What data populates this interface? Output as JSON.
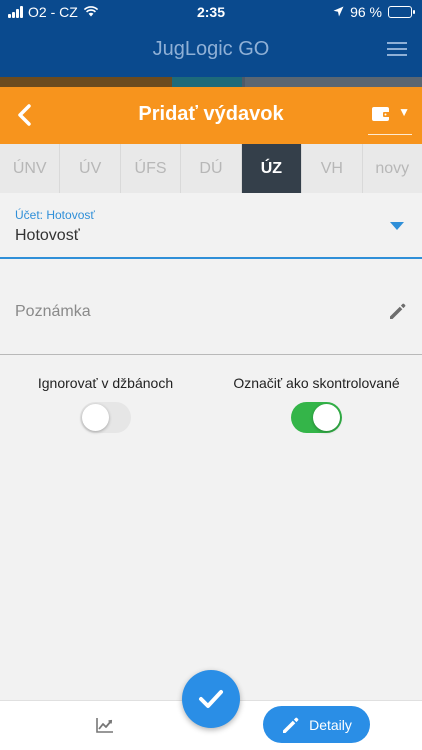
{
  "status": {
    "carrier": "O2 - CZ",
    "time": "2:35",
    "battery": "96 %",
    "battery_level": 0.96
  },
  "app": {
    "title": "JugLogic GO",
    "menu_icon": "hamburger-icon"
  },
  "modal": {
    "title": "Pridať výdavok",
    "back_icon": "chevron-left-icon",
    "wallet_icon": "wallet-icon"
  },
  "tabs": [
    {
      "label": "ÚNV",
      "active": false
    },
    {
      "label": "ÚV",
      "active": false
    },
    {
      "label": "ÚFS",
      "active": false
    },
    {
      "label": "DÚ",
      "active": false
    },
    {
      "label": "ÚZ",
      "active": true
    },
    {
      "label": "VH",
      "active": false
    },
    {
      "label": "novy",
      "active": false
    }
  ],
  "form": {
    "account_label": "Účet: Hotovosť",
    "account_value": "Hotovosť",
    "note_placeholder": "Poznámka",
    "ignore_label": "Ignorovať v džbánoch",
    "ignore_on": false,
    "checked_label": "Označiť ako skontrolované",
    "checked_on": true
  },
  "bottom": {
    "details_label": "Detaily",
    "confirm_icon": "checkmark-icon",
    "chart_icon": "trend-chart-icon"
  },
  "colors": {
    "header_blue": "#0a4a8e",
    "accent_orange": "#f7941d",
    "active_tab": "#343f4a",
    "primary_blue": "#2a8ee6",
    "switch_green": "#34b549"
  }
}
